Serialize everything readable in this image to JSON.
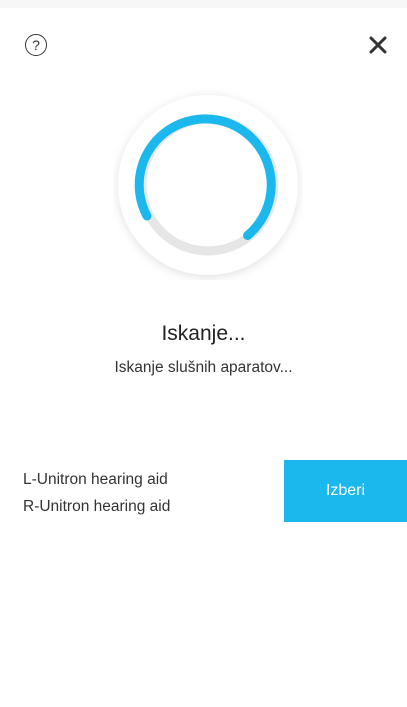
{
  "header": {
    "help_icon": "question-circle-icon",
    "help_glyph": "?",
    "close_icon": "close-icon"
  },
  "scan": {
    "title": "Iskanje...",
    "subtitle": "Iskanje slušnih aparatov...",
    "progress_color": "#1ab8ec",
    "track_color": "#e6e6e6"
  },
  "devices": {
    "items": [
      {
        "label": "L-Unitron hearing aid"
      },
      {
        "label": "R-Unitron hearing aid"
      }
    ],
    "select_label": "Izberi"
  },
  "colors": {
    "accent": "#1ab8ec",
    "text": "#333333"
  }
}
